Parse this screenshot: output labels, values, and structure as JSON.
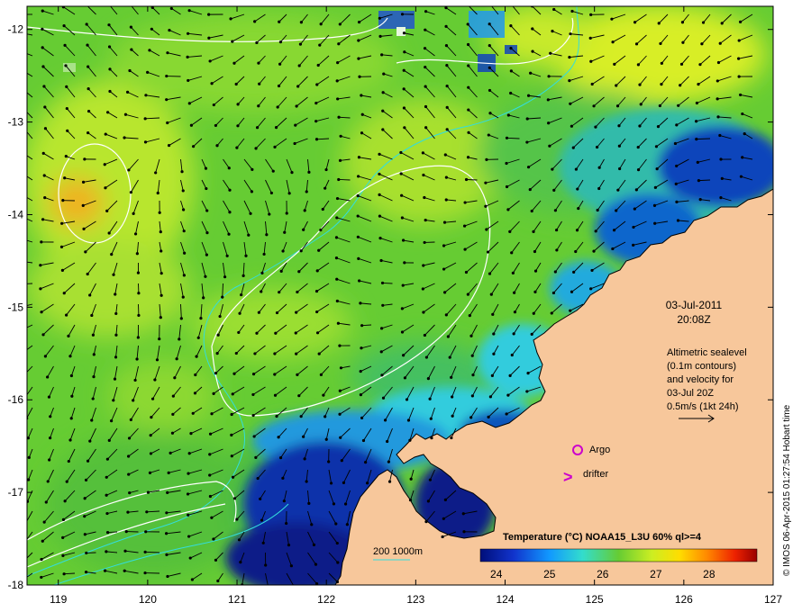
{
  "map": {
    "date_line": "03-Jul-2011",
    "time_line": "20:08Z",
    "altimetry_caption": [
      "Altimetric sealevel",
      "(0.1m contours)",
      "and velocity for",
      "03-Jul 20Z",
      "0.5m/s (1kt 24h)"
    ],
    "argo_label": "Argo",
    "drifter_label": "drifter",
    "drifter_symbol": ">",
    "depth_legend_label": "200  1000m",
    "colorbar_title": "Temperature (°C) NOAA15_L3U 60% ql>=4",
    "colorbar_ticks": [
      "24",
      "25",
      "26",
      "27",
      "28"
    ],
    "credit": "© IMOS 06-Apr-2015 01:27:54 Hobart time"
  },
  "axes": {
    "lon_ticks": [
      "119",
      "120",
      "121",
      "122",
      "123",
      "124",
      "125",
      "126",
      "127"
    ],
    "lat_ticks": [
      "-12",
      "-13",
      "-14",
      "-15",
      "-16",
      "-17",
      "-18"
    ],
    "lon_range": [
      118.65,
      127.0
    ],
    "lat_range": [
      -18.0,
      -11.75
    ]
  },
  "colors": {
    "land": "#f7c79b",
    "ocean_base": "#66cc33",
    "warm": "#ccee33",
    "cool": "#33bbaa",
    "cold": "#1133aa",
    "coldest": "#000f7a",
    "warmest": "#f5a623",
    "contour": "#ffffff",
    "bathymetry": "#33dddd",
    "argo": "#cc00cc"
  }
}
